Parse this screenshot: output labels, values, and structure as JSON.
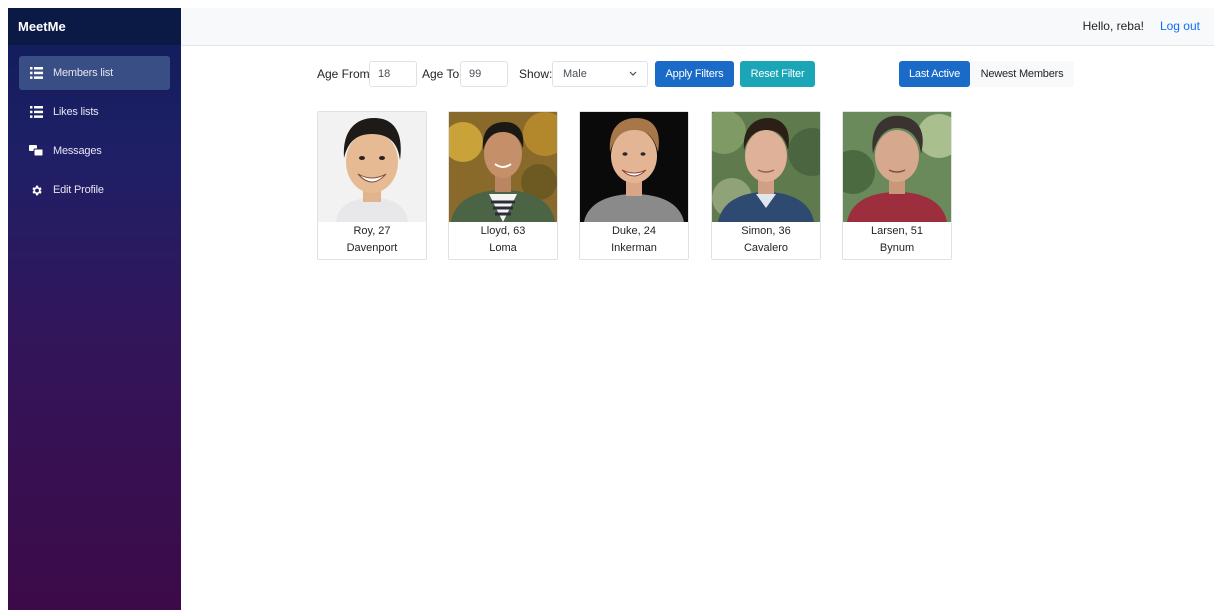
{
  "app": {
    "brand": "MeetMe"
  },
  "sidebar": {
    "items": [
      {
        "label": "Members list",
        "icon": "list-icon",
        "active": true
      },
      {
        "label": "Likes lists",
        "icon": "list-icon",
        "active": false
      },
      {
        "label": "Messages",
        "icon": "messages-icon",
        "active": false
      },
      {
        "label": "Edit Profile",
        "icon": "gear-icon",
        "active": false
      }
    ]
  },
  "header": {
    "greeting": "Hello, reba!",
    "logout": "Log out"
  },
  "filters": {
    "age_from_label": "Age From",
    "age_from_value": "18",
    "age_to_label": "Age To",
    "age_to_value": "99",
    "show_label": "Show:",
    "show_value": "Male",
    "apply_label": "Apply Filters",
    "reset_label": "Reset Filter",
    "sort_last_active": "Last Active",
    "sort_newest": "Newest Members"
  },
  "members": [
    {
      "name_age": "Roy, 27",
      "city": "Davenport"
    },
    {
      "name_age": "Lloyd, 63",
      "city": "Loma"
    },
    {
      "name_age": "Duke, 24",
      "city": "Inkerman"
    },
    {
      "name_age": "Simon, 36",
      "city": "Cavalero"
    },
    {
      "name_age": "Larsen, 51",
      "city": "Bynum"
    }
  ],
  "colors": {
    "primary": "#1a6bc7",
    "info": "#1aa6b7",
    "link": "#0d6efd"
  }
}
